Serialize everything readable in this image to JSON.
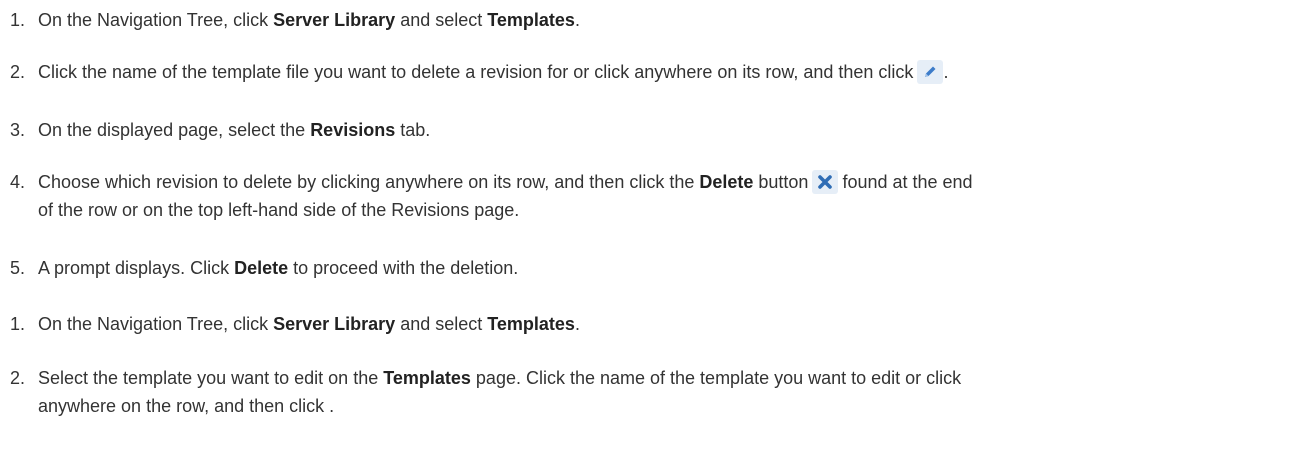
{
  "steps": [
    {
      "num": "1.",
      "t1": "On the Navigation Tree, click ",
      "b1": "Server Library",
      "t2": " and select ",
      "b2": "Templates",
      "t3": "."
    },
    {
      "num": "2.",
      "t1": "Click the name of the template file you want to delete a revision for or click anywhere on its row, and then click",
      "icon": "edit-pencil-icon",
      "t2": "."
    },
    {
      "num": "3.",
      "t1": "On the displayed page, select the ",
      "b1": "Revisions",
      "t2": " tab."
    },
    {
      "num": "4.",
      "t1": "Choose which revision to delete by clicking anywhere on its row, and then click the ",
      "b1": "Delete",
      "t2": " button",
      "icon": "delete-x-icon",
      "t3": "found at the end",
      "t4": "of the row or on the top left-hand side of the Revisions page."
    },
    {
      "num": "5.",
      "t1": "A prompt displays. Click ",
      "b1": "Delete",
      "t2": " to proceed with the deletion."
    },
    {
      "num": "1.",
      "t1": "On the Navigation Tree, click ",
      "b1": "Server Library",
      "t2": " and select ",
      "b2": "Templates",
      "t3": "."
    },
    {
      "num": "2.",
      "t1": "Select the template you want to edit on the ",
      "b1": "Templates",
      "t2": " page. Click the name of the template you want to edit or click",
      "t3": "anywhere on the row, and then click ."
    }
  ],
  "colors": {
    "text": "#333333",
    "icon_bg": "#e6eef7",
    "pencil": "#3d7cc9",
    "x": "#2f6db5"
  }
}
